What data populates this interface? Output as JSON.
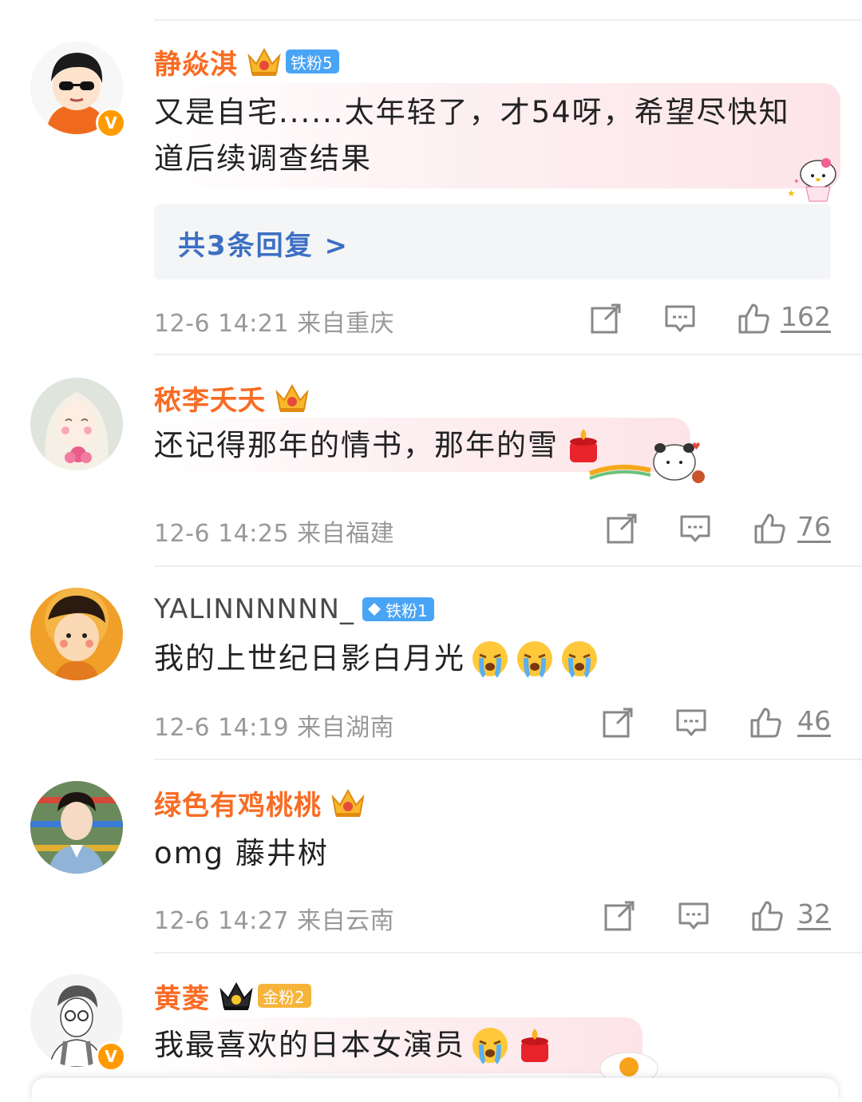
{
  "comments": [
    {
      "username": "静焱淇",
      "fan_badge": "铁粉5",
      "verified": "V",
      "text_line1": "又是自宅......太年轻了，才54呀，希望尽快知",
      "text_line2": "道后续调查结果",
      "replies": "共3条回复 >",
      "meta": "12-6 14:21  来自重庆",
      "likes": "162"
    },
    {
      "username": "秾李夭夭",
      "text": "还记得那年的情书，那年的雪",
      "meta": "12-6 14:25  来自福建",
      "likes": "76"
    },
    {
      "username": "YALINNNNNN_",
      "fan_badge": "铁粉1",
      "text": "我的上世纪日影白月光",
      "meta": "12-6 14:19  来自湖南",
      "likes": "46"
    },
    {
      "username": "绿色有鸡桃桃",
      "text": "omg 藤井树",
      "meta": "12-6 14:27  来自云南",
      "likes": "32"
    },
    {
      "username": "黄菱",
      "fan_badge": "金粉2",
      "verified": "V",
      "text": "我最喜欢的日本女演员"
    }
  ],
  "icons": {
    "share": "share-icon",
    "comment": "comment-icon",
    "like": "thumbs-up-icon",
    "crown": "crown-icon"
  },
  "colors": {
    "username": "#f86c24",
    "reply_link": "#3d6fc3",
    "meta": "#999999",
    "iron_fan_badge": "#4aa4f5",
    "gold_fan_badge": "#f6b43a",
    "verified": "#ff9a00"
  }
}
